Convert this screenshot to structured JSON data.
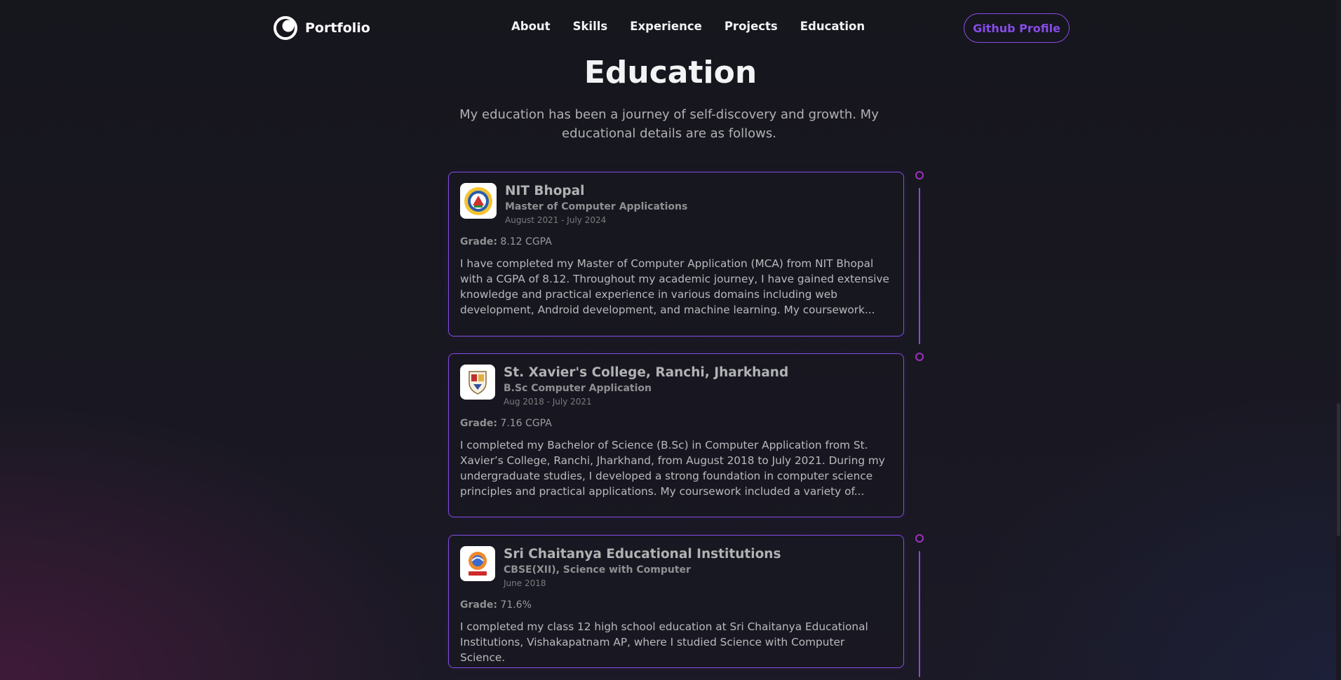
{
  "nav": {
    "brand": "Portfolio",
    "links": [
      "About",
      "Skills",
      "Experience",
      "Projects",
      "Education"
    ],
    "github_button": "Github Profile"
  },
  "section": {
    "title": "Education",
    "description": "My education has been a journey of self-discovery and growth. My educational details are as follows."
  },
  "education": [
    {
      "school": "NIT Bhopal",
      "degree": "Master of Computer Applications",
      "date": "August 2021 - July 2024",
      "grade_label": "Grade:",
      "grade": "8.12 CGPA",
      "description": "I have completed my Master of Computer Application (MCA) from NIT Bhopal with a CGPA of 8.12. Throughout my academic journey, I have gained extensive knowledge and practical experience in various domains including web development, Android development, and machine learning. My coursework..."
    },
    {
      "school": "St. Xavier's College, Ranchi, Jharkhand",
      "degree": "B.Sc Computer Application",
      "date": "Aug 2018 - July 2021",
      "grade_label": "Grade:",
      "grade": "7.16 CGPA",
      "description": "I completed my Bachelor of Science (B.Sc) in Computer Application from St. Xavier’s College, Ranchi, Jharkhand, from August 2018 to July 2021. During my undergraduate studies, I developed a strong foundation in computer science principles and practical applications. My coursework included a variety of..."
    },
    {
      "school": "Sri Chaitanya Educational Institutions",
      "degree": "CBSE(XII), Science with Computer",
      "date": "June 2018",
      "grade_label": "Grade:",
      "grade": "71.6%",
      "description": "I completed my class 12 high school education at Sri Chaitanya Educational Institutions, Vishakapatnam AP, where I studied Science with Computer Science."
    }
  ],
  "colors": {
    "accent": "#854ce6",
    "timeline_dot": "#a030c0",
    "background": "#17161e"
  },
  "icons": {
    "brand": "portfolio-ring-icon",
    "logos": [
      "nit-bhopal-logo",
      "st-xaviers-logo",
      "sri-chaitanya-logo"
    ]
  }
}
